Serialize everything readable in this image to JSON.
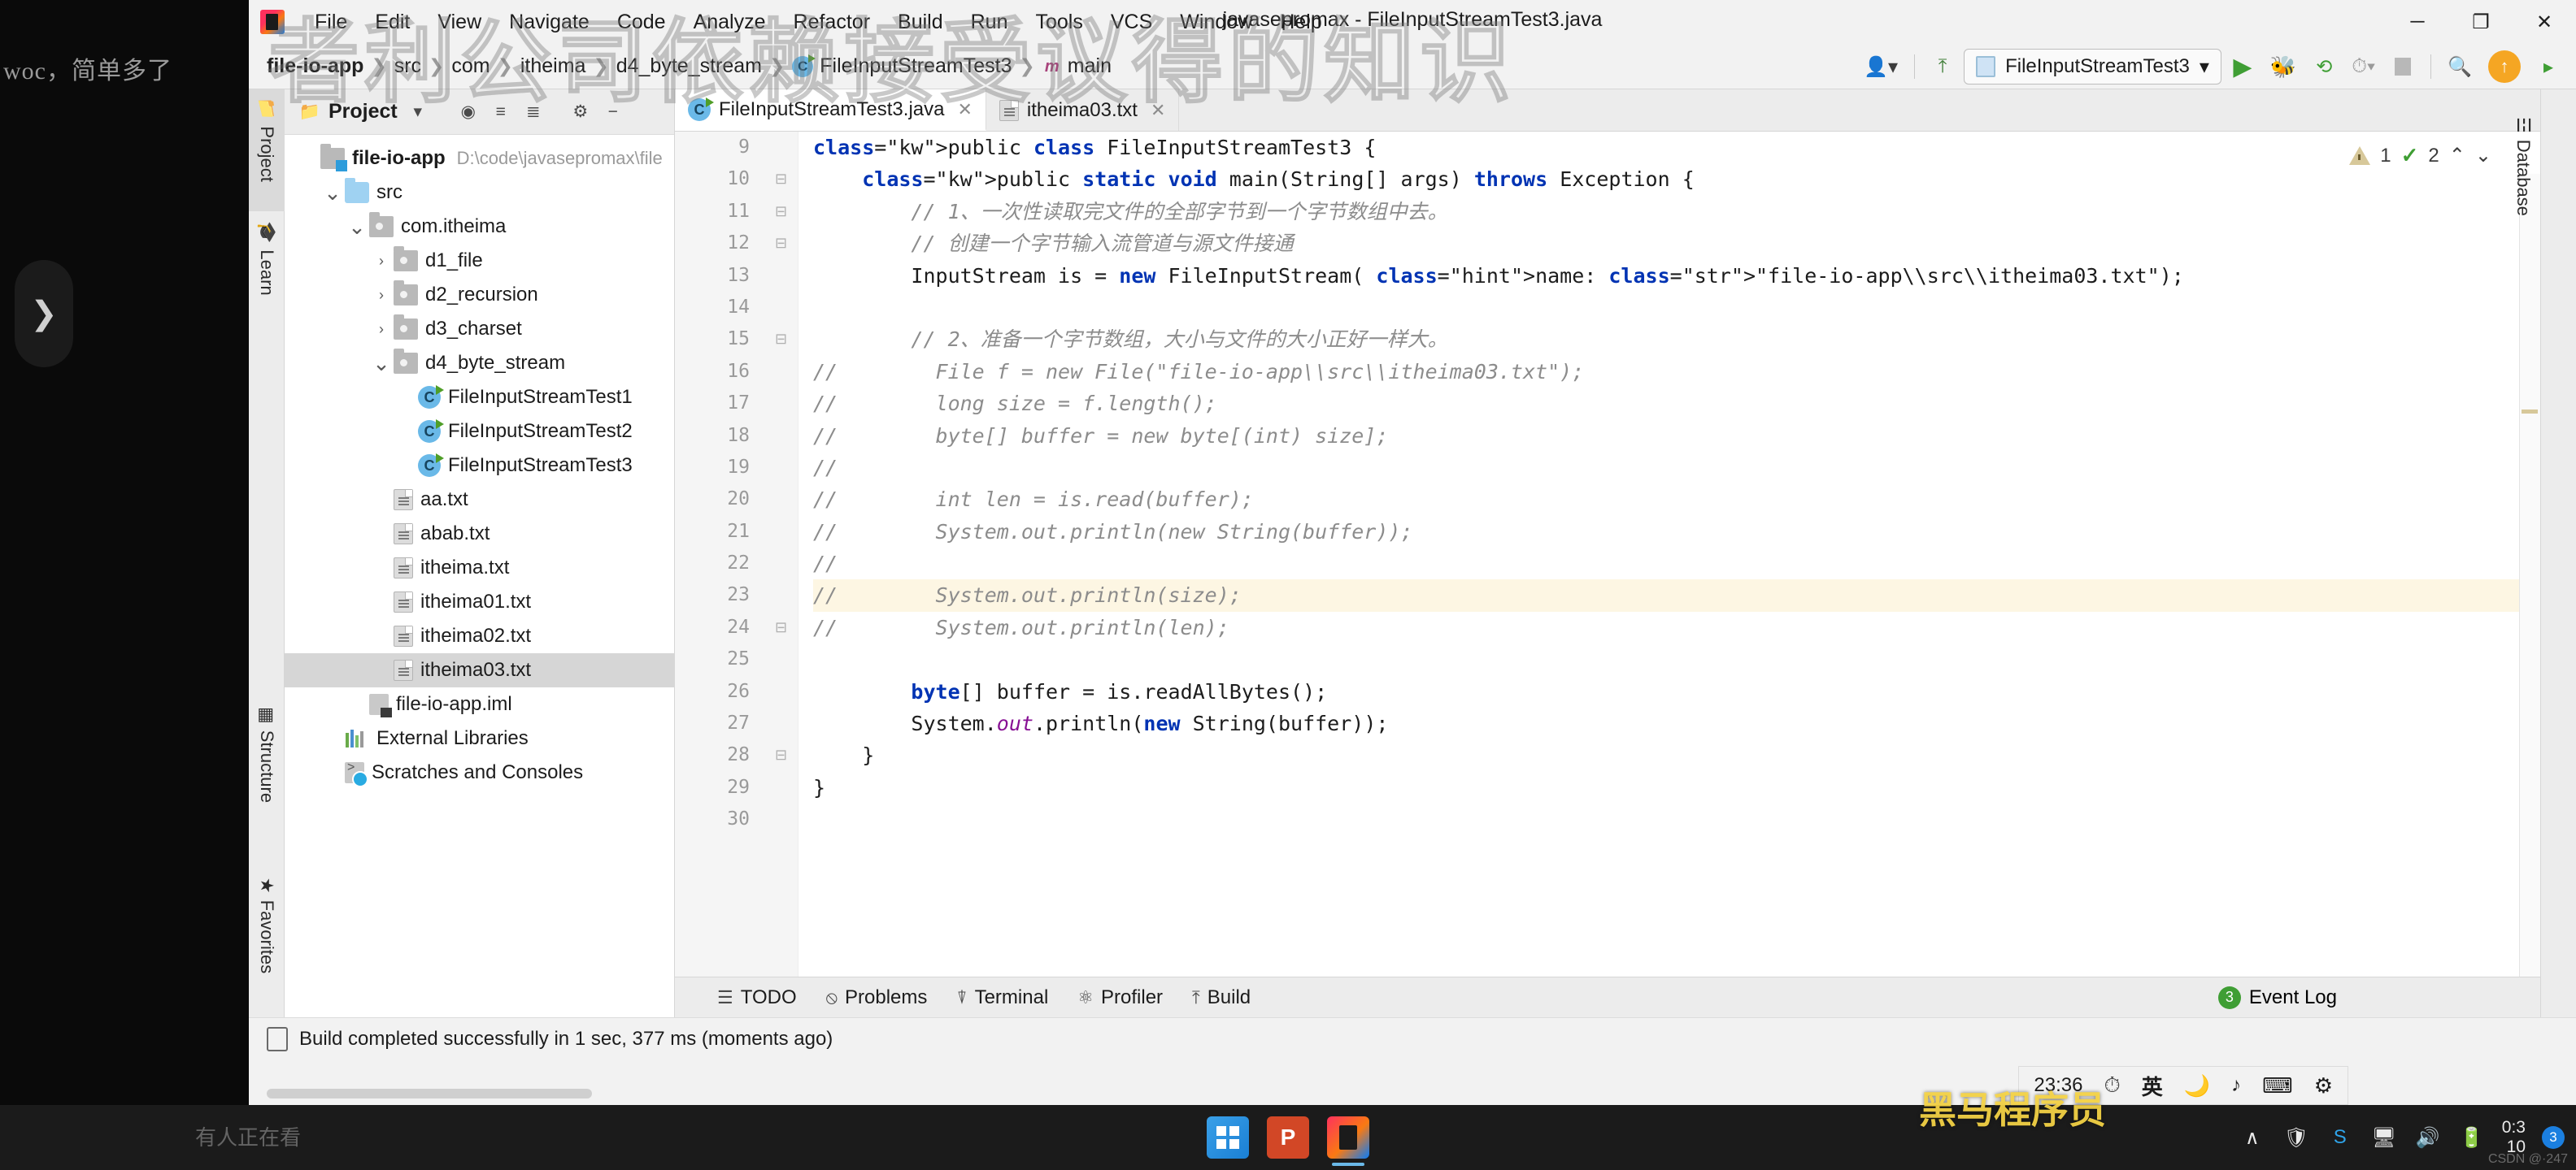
{
  "window": {
    "title": "javasepromax - FileInputStreamTest3.java",
    "controls": {
      "minimize": "─",
      "maximize": "❐",
      "close": "✕"
    }
  },
  "menubar": {
    "app_icon": "intellij-idea-icon",
    "items": [
      "File",
      "Edit",
      "View",
      "Navigate",
      "Code",
      "Analyze",
      "Refactor",
      "Build",
      "Run",
      "Tools",
      "VCS",
      "Window",
      "Help"
    ]
  },
  "navbar": {
    "breadcrumb": [
      {
        "label": "file-io-app",
        "bold": true,
        "icon": ""
      },
      {
        "label": "src",
        "bold": false,
        "icon": ""
      },
      {
        "label": "com",
        "bold": false,
        "icon": ""
      },
      {
        "label": "itheima",
        "bold": false,
        "icon": ""
      },
      {
        "label": "d4_byte_stream",
        "bold": false,
        "icon": ""
      },
      {
        "label": "FileInputStreamTest3",
        "bold": false,
        "icon": "class-icon"
      },
      {
        "label": "main",
        "bold": false,
        "icon": "method-icon"
      }
    ],
    "right": {
      "account_icon": "user-account-icon",
      "build_icon": "hammer-icon",
      "run_config": "FileInputStreamTest3",
      "run_icon": "run-play-icon",
      "debug_icon": "debug-bug-icon",
      "run_coverage_icon": "run-with-coverage-icon",
      "profile_icon": "profile-icon",
      "stop_icon": "stop-icon",
      "search_icon": "search-everywhere-icon",
      "update_icon": "update-project-icon",
      "browser_icon": "open-in-browser-icon"
    }
  },
  "left_toolbar": [
    {
      "label": "Project",
      "icon": "project-folder-icon",
      "active": true
    },
    {
      "label": "Learn",
      "icon": "learn-graduation-icon",
      "active": false
    },
    {
      "label": "Structure",
      "icon": "structure-icon",
      "active": false
    },
    {
      "label": "Favorites",
      "icon": "favorites-star-icon",
      "active": false
    }
  ],
  "right_toolbar": [
    {
      "label": "Database",
      "icon": "database-icon",
      "active": false
    }
  ],
  "project_panel": {
    "title": "Project",
    "header_icons": [
      "project-view-select-icon",
      "collapse-all-icon",
      "expand-icon",
      "settings-gear-icon",
      "hide-icon"
    ],
    "tree": [
      {
        "indent": 0,
        "arrow": "",
        "icon": "module-icon",
        "label": "file-io-app",
        "bold": true,
        "dim": "D:\\code\\javasepromax\\file",
        "selected": false
      },
      {
        "indent": 1,
        "arrow": "v",
        "icon": "folder-icon",
        "label": "src",
        "bold": false,
        "dim": "",
        "selected": false
      },
      {
        "indent": 2,
        "arrow": "v",
        "icon": "package-icon",
        "label": "com.itheima",
        "bold": false,
        "dim": "",
        "selected": false
      },
      {
        "indent": 3,
        "arrow": ">",
        "icon": "package-icon",
        "label": "d1_file",
        "bold": false,
        "dim": "",
        "selected": false
      },
      {
        "indent": 3,
        "arrow": ">",
        "icon": "package-icon",
        "label": "d2_recursion",
        "bold": false,
        "dim": "",
        "selected": false
      },
      {
        "indent": 3,
        "arrow": ">",
        "icon": "package-icon",
        "label": "d3_charset",
        "bold": false,
        "dim": "",
        "selected": false
      },
      {
        "indent": 3,
        "arrow": "v",
        "icon": "package-icon",
        "label": "d4_byte_stream",
        "bold": false,
        "dim": "",
        "selected": false
      },
      {
        "indent": 4,
        "arrow": "",
        "icon": "java-class-icon",
        "label": "FileInputStreamTest1",
        "bold": false,
        "dim": "",
        "selected": false
      },
      {
        "indent": 4,
        "arrow": "",
        "icon": "java-class-icon",
        "label": "FileInputStreamTest2",
        "bold": false,
        "dim": "",
        "selected": false
      },
      {
        "indent": 4,
        "arrow": "",
        "icon": "java-class-icon",
        "label": "FileInputStreamTest3",
        "bold": false,
        "dim": "",
        "selected": false
      },
      {
        "indent": 3,
        "arrow": "",
        "icon": "text-file-icon",
        "label": "aa.txt",
        "bold": false,
        "dim": "",
        "selected": false
      },
      {
        "indent": 3,
        "arrow": "",
        "icon": "text-file-icon",
        "label": "abab.txt",
        "bold": false,
        "dim": "",
        "selected": false
      },
      {
        "indent": 3,
        "arrow": "",
        "icon": "text-file-icon",
        "label": "itheima.txt",
        "bold": false,
        "dim": "",
        "selected": false
      },
      {
        "indent": 3,
        "arrow": "",
        "icon": "text-file-icon",
        "label": "itheima01.txt",
        "bold": false,
        "dim": "",
        "selected": false
      },
      {
        "indent": 3,
        "arrow": "",
        "icon": "text-file-icon",
        "label": "itheima02.txt",
        "bold": false,
        "dim": "",
        "selected": false
      },
      {
        "indent": 3,
        "arrow": "",
        "icon": "text-file-icon",
        "label": "itheima03.txt",
        "bold": false,
        "dim": "",
        "selected": true
      },
      {
        "indent": 2,
        "arrow": "",
        "icon": "iml-file-icon",
        "label": "file-io-app.iml",
        "bold": false,
        "dim": "",
        "selected": false
      },
      {
        "indent": 1,
        "arrow": "",
        "icon": "external-libraries-icon",
        "label": "External Libraries",
        "bold": false,
        "dim": "",
        "selected": false
      },
      {
        "indent": 1,
        "arrow": "",
        "icon": "scratches-icon",
        "label": "Scratches and Consoles",
        "bold": false,
        "dim": "",
        "selected": false
      }
    ]
  },
  "editor": {
    "tabs": [
      {
        "label": "FileInputStreamTest3.java",
        "icon": "java-class-icon",
        "active": true,
        "close": "✕"
      },
      {
        "label": "itheima03.txt",
        "icon": "text-file-icon",
        "active": false,
        "close": "✕"
      }
    ],
    "inspections": {
      "warning_count": "1",
      "check_count": "2",
      "up": "⌃",
      "down": "⌄"
    },
    "first_visible_line": 9,
    "highlight_line": 23,
    "run_marker_lines": [
      9,
      10
    ],
    "lines": [
      {
        "n": 9,
        "fold": "",
        "text": "public class FileInputStreamTest3 {"
      },
      {
        "n": 10,
        "fold": "-",
        "text": "    public static void main(String[] args) throws Exception {"
      },
      {
        "n": 11,
        "fold": "-",
        "text": "        // 1、一次性读取完文件的全部字节到一个字节数组中去。"
      },
      {
        "n": 12,
        "fold": "-",
        "text": "        // 创建一个字节输入流管道与源文件接通"
      },
      {
        "n": 13,
        "fold": "",
        "text": "        InputStream is = new FileInputStream( name: \"file-io-app\\\\src\\\\itheima03.txt\");"
      },
      {
        "n": 14,
        "fold": "",
        "text": ""
      },
      {
        "n": 15,
        "fold": "-",
        "text": "        // 2、准备一个字节数组，大小与文件的大小正好一样大。"
      },
      {
        "n": 16,
        "fold": "",
        "text": "//        File f = new File(\"file-io-app\\\\src\\\\itheima03.txt\");"
      },
      {
        "n": 17,
        "fold": "",
        "text": "//        long size = f.length();"
      },
      {
        "n": 18,
        "fold": "",
        "text": "//        byte[] buffer = new byte[(int) size];"
      },
      {
        "n": 19,
        "fold": "",
        "text": "//"
      },
      {
        "n": 20,
        "fold": "",
        "text": "//        int len = is.read(buffer);"
      },
      {
        "n": 21,
        "fold": "",
        "text": "//        System.out.println(new String(buffer));"
      },
      {
        "n": 22,
        "fold": "",
        "text": "//"
      },
      {
        "n": 23,
        "fold": "",
        "text": "//        System.out.println(size);"
      },
      {
        "n": 24,
        "fold": "-",
        "text": "//        System.out.println(len);"
      },
      {
        "n": 25,
        "fold": "",
        "text": ""
      },
      {
        "n": 26,
        "fold": "",
        "text": "        byte[] buffer = is.readAllBytes();"
      },
      {
        "n": 27,
        "fold": "",
        "text": "        System.out.println(new String(buffer));"
      },
      {
        "n": 28,
        "fold": "-",
        "text": "    }"
      },
      {
        "n": 29,
        "fold": "",
        "text": "}"
      },
      {
        "n": 30,
        "fold": "",
        "text": ""
      }
    ]
  },
  "tool_windows": [
    {
      "label": "TODO",
      "icon": "todo-list-icon"
    },
    {
      "label": "Problems",
      "icon": "problems-icon"
    },
    {
      "label": "Terminal",
      "icon": "terminal-icon"
    },
    {
      "label": "Profiler",
      "icon": "profiler-icon"
    },
    {
      "label": "Build",
      "icon": "build-hammer-icon"
    }
  ],
  "event_log": {
    "label": "Event Log",
    "count": "3"
  },
  "status_bar": {
    "message": "Build completed successfully in 1 sec, 377 ms (moments ago)",
    "icon": "memory-indicator-icon"
  },
  "taskbar": {
    "apps": [
      {
        "name": "windows-start-icon"
      },
      {
        "name": "powerpoint-icon",
        "letter": "P"
      },
      {
        "name": "intellij-idea-icon",
        "active": true
      }
    ],
    "tray": {
      "chevron": "∧",
      "icons": [
        "tray-shield-icon",
        "tray-sogou-icon",
        "tray-network-icon",
        "tray-volume-icon",
        "tray-battery-icon"
      ],
      "clock_time": "0:3",
      "clock_date": "10",
      "notification_count": "3"
    },
    "ime": {
      "time": "23:36",
      "speed": "speed-gauge-icon",
      "lang": "英",
      "moon": "moon-icon",
      "note": "note-icon",
      "keyboard": "keyboard-icon",
      "gear": "gear-icon"
    }
  },
  "watermark": {
    "big_text": "者利公司依赖接受议得的知识",
    "left_text": "woc，简单多了",
    "left_arrow": "❯",
    "bottom_cn": "黑马程序员",
    "bottom_left": "有人正在看",
    "csdn": "CSDN @·247"
  }
}
